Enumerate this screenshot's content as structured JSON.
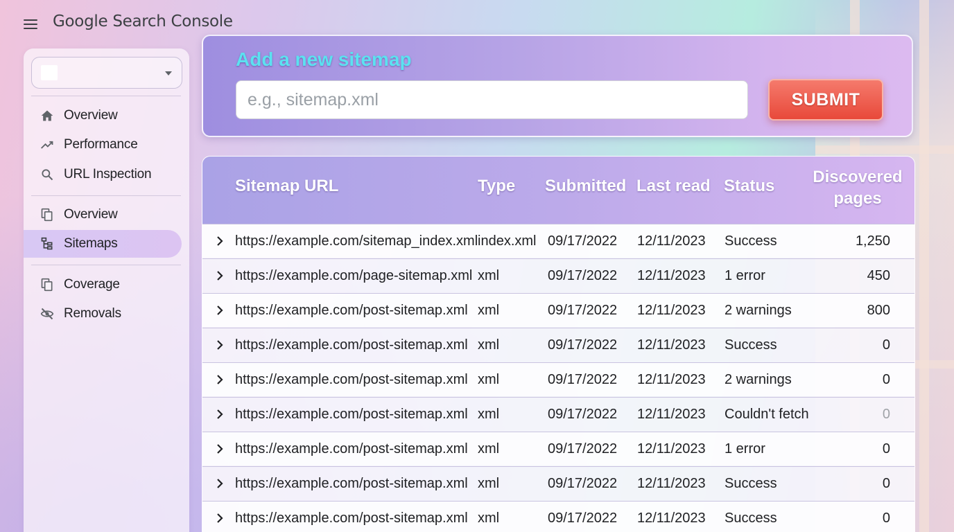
{
  "app": {
    "title": "Google Search Console"
  },
  "sidebar": {
    "property_selector": {
      "value": ""
    },
    "groups": [
      [
        {
          "label": "Overview",
          "icon": "home-icon"
        },
        {
          "label": "Performance",
          "icon": "trending-up-icon"
        },
        {
          "label": "URL Inspection",
          "icon": "search-icon"
        }
      ],
      [
        {
          "label": "Overview",
          "icon": "copy-icon"
        },
        {
          "label": "Sitemaps",
          "icon": "sitemap-icon",
          "active": true
        }
      ],
      [
        {
          "label": "Coverage",
          "icon": "copy-icon"
        },
        {
          "label": "Removals",
          "icon": "eye-off-icon"
        }
      ]
    ]
  },
  "add_sitemap": {
    "title": "Add a new sitemap",
    "placeholder": "e.g., sitemap.xml",
    "value": "",
    "submit_label": "SUBMIT"
  },
  "table": {
    "headers": {
      "url": "Sitemap URL",
      "type": "Type",
      "submitted": "Submitted",
      "last_read": "Last read",
      "status": "Status",
      "discovered_line1": "Discovered",
      "discovered_line2": "pages"
    },
    "rows": [
      {
        "url": "https://example.com/sitemap_index.xml",
        "type": "index.xml",
        "submitted": "09/17/2022",
        "last_read": "12/11/2023",
        "status": "Success",
        "status_kind": "success",
        "discovered": "1,250"
      },
      {
        "url": "https://example.com/page-sitemap.xml",
        "type": "xml",
        "submitted": "09/17/2022",
        "last_read": "12/11/2023",
        "status": "1 error",
        "status_kind": "error",
        "discovered": "450"
      },
      {
        "url": "https://example.com/post-sitemap.xml",
        "type": "xml",
        "submitted": "09/17/2022",
        "last_read": "12/11/2023",
        "status": "2 warnings",
        "status_kind": "warning",
        "discovered": "800"
      },
      {
        "url": "https://example.com/post-sitemap.xml",
        "type": "xml",
        "submitted": "09/17/2022",
        "last_read": "12/11/2023",
        "status": "Success",
        "status_kind": "success",
        "discovered": "0"
      },
      {
        "url": "https://example.com/post-sitemap.xml",
        "type": "xml",
        "submitted": "09/17/2022",
        "last_read": "12/11/2023",
        "status": "2 warnings",
        "status_kind": "warning",
        "discovered": "0"
      },
      {
        "url": "https://example.com/post-sitemap.xml",
        "type": "xml",
        "submitted": "09/17/2022",
        "last_read": "12/11/2023",
        "status": "Couldn't fetch",
        "status_kind": "fetch",
        "discovered": "0"
      },
      {
        "url": "https://example.com/post-sitemap.xml",
        "type": "xml",
        "submitted": "09/17/2022",
        "last_read": "12/11/2023",
        "status": "1 error",
        "status_kind": "error",
        "discovered": "0"
      },
      {
        "url": "https://example.com/post-sitemap.xml",
        "type": "xml",
        "submitted": "09/17/2022",
        "last_read": "12/11/2023",
        "status": "Success",
        "status_kind": "success",
        "discovered": "0"
      },
      {
        "url": "https://example.com/post-sitemap.xml",
        "type": "xml",
        "submitted": "09/17/2022",
        "last_read": "12/11/2023",
        "status": "Success",
        "status_kind": "success",
        "discovered": "0"
      }
    ]
  },
  "colors": {
    "status_success": "#2fb2c6",
    "status_error": "#e06b55",
    "status_warning": "#e8923a",
    "status_fetch": "#7a7f86",
    "submit_button": "#e8493a",
    "title_accent": "#5ce1f0"
  }
}
